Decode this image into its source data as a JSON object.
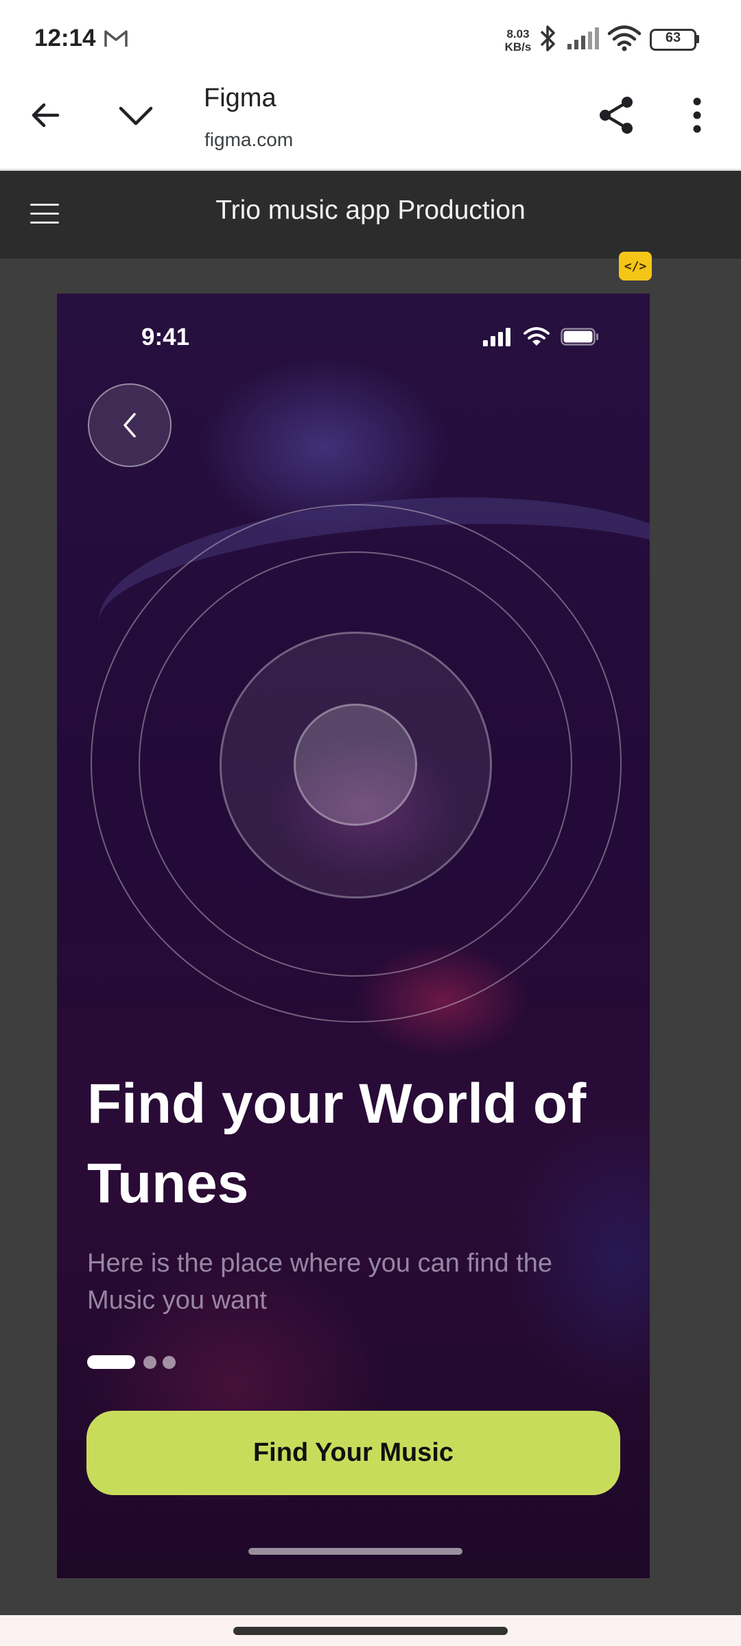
{
  "status_bar": {
    "time": "12:14",
    "notification_icon": "gmail-icon",
    "net_speed_value": "8.03",
    "net_speed_unit": "KB/s",
    "battery": "63"
  },
  "browser": {
    "title": "Figma",
    "url": "figma.com"
  },
  "figma": {
    "file_title": "Trio music app Production",
    "dev_mode_badge": "</>"
  },
  "screen": {
    "status_time": "9:41",
    "headline": "Find your World of Tunes",
    "subtitle": "Here is the place where you can find the Music you want",
    "pagination": {
      "total": 3,
      "active": 1
    },
    "cta_label": "Find Your Music"
  },
  "colors": {
    "cta_background": "#c8dc5c",
    "figma_header": "#2c2c2c",
    "figma_canvas": "#3e3e3e",
    "dev_badge": "#f5c518"
  }
}
